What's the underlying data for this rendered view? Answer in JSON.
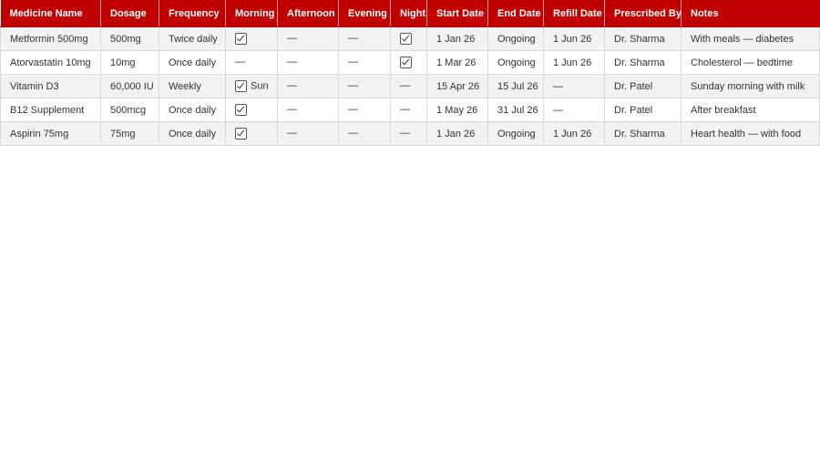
{
  "columns": [
    "Medicine Name",
    "Dosage",
    "Frequency",
    "Morning",
    "Afternoon",
    "Evening",
    "Night",
    "Start Date",
    "End Date",
    "Refill Date",
    "Prescribed By",
    "Notes"
  ],
  "rows": [
    {
      "medicine": "Metformin 500mg",
      "dosage": "500mg",
      "frequency": "Twice daily",
      "morning": {
        "checked": true,
        "text": ""
      },
      "afternoon": {
        "checked": false,
        "text": "—"
      },
      "evening": {
        "checked": false,
        "text": "—"
      },
      "night": {
        "checked": true,
        "text": ""
      },
      "start": "1 Jan 26",
      "end": "Ongoing",
      "refill": "1 Jun 26",
      "prescriber": "Dr. Sharma",
      "notes": "With meals — diabetes"
    },
    {
      "medicine": "Atorvastatin 10mg",
      "dosage": "10mg",
      "frequency": "Once daily",
      "morning": {
        "checked": false,
        "text": "—"
      },
      "afternoon": {
        "checked": false,
        "text": "—"
      },
      "evening": {
        "checked": false,
        "text": "—"
      },
      "night": {
        "checked": true,
        "text": ""
      },
      "start": "1 Mar 26",
      "end": "Ongoing",
      "refill": "1 Jun 26",
      "prescriber": "Dr. Sharma",
      "notes": "Cholesterol — bedtime"
    },
    {
      "medicine": "Vitamin D3",
      "dosage": "60,000 IU",
      "frequency": "Weekly",
      "morning": {
        "checked": true,
        "text": "Sun"
      },
      "afternoon": {
        "checked": false,
        "text": "—"
      },
      "evening": {
        "checked": false,
        "text": "—"
      },
      "night": {
        "checked": false,
        "text": "—"
      },
      "start": "15 Apr 26",
      "end": "15 Jul 26",
      "refill": "—",
      "prescriber": "Dr. Patel",
      "notes": "Sunday morning with milk"
    },
    {
      "medicine": "B12 Supplement",
      "dosage": "500mcg",
      "frequency": "Once daily",
      "morning": {
        "checked": true,
        "text": ""
      },
      "afternoon": {
        "checked": false,
        "text": "—"
      },
      "evening": {
        "checked": false,
        "text": "—"
      },
      "night": {
        "checked": false,
        "text": "—"
      },
      "start": "1 May 26",
      "end": "31 Jul 26",
      "refill": "—",
      "prescriber": "Dr. Patel",
      "notes": "After breakfast"
    },
    {
      "medicine": "Aspirin 75mg",
      "dosage": "75mg",
      "frequency": "Once daily",
      "morning": {
        "checked": true,
        "text": ""
      },
      "afternoon": {
        "checked": false,
        "text": "—"
      },
      "evening": {
        "checked": false,
        "text": "—"
      },
      "night": {
        "checked": false,
        "text": "—"
      },
      "start": "1 Jan 26",
      "end": "Ongoing",
      "refill": "1 Jun 26",
      "prescriber": "Dr. Sharma",
      "notes": "Heart health — with food"
    }
  ],
  "colors": {
    "header_bg": "#c00000",
    "header_text": "#ffffff",
    "band_row": "#f2f2f2",
    "grid": "#d9d9d9"
  },
  "icons": {
    "checked": "checkbox-checked-icon"
  }
}
